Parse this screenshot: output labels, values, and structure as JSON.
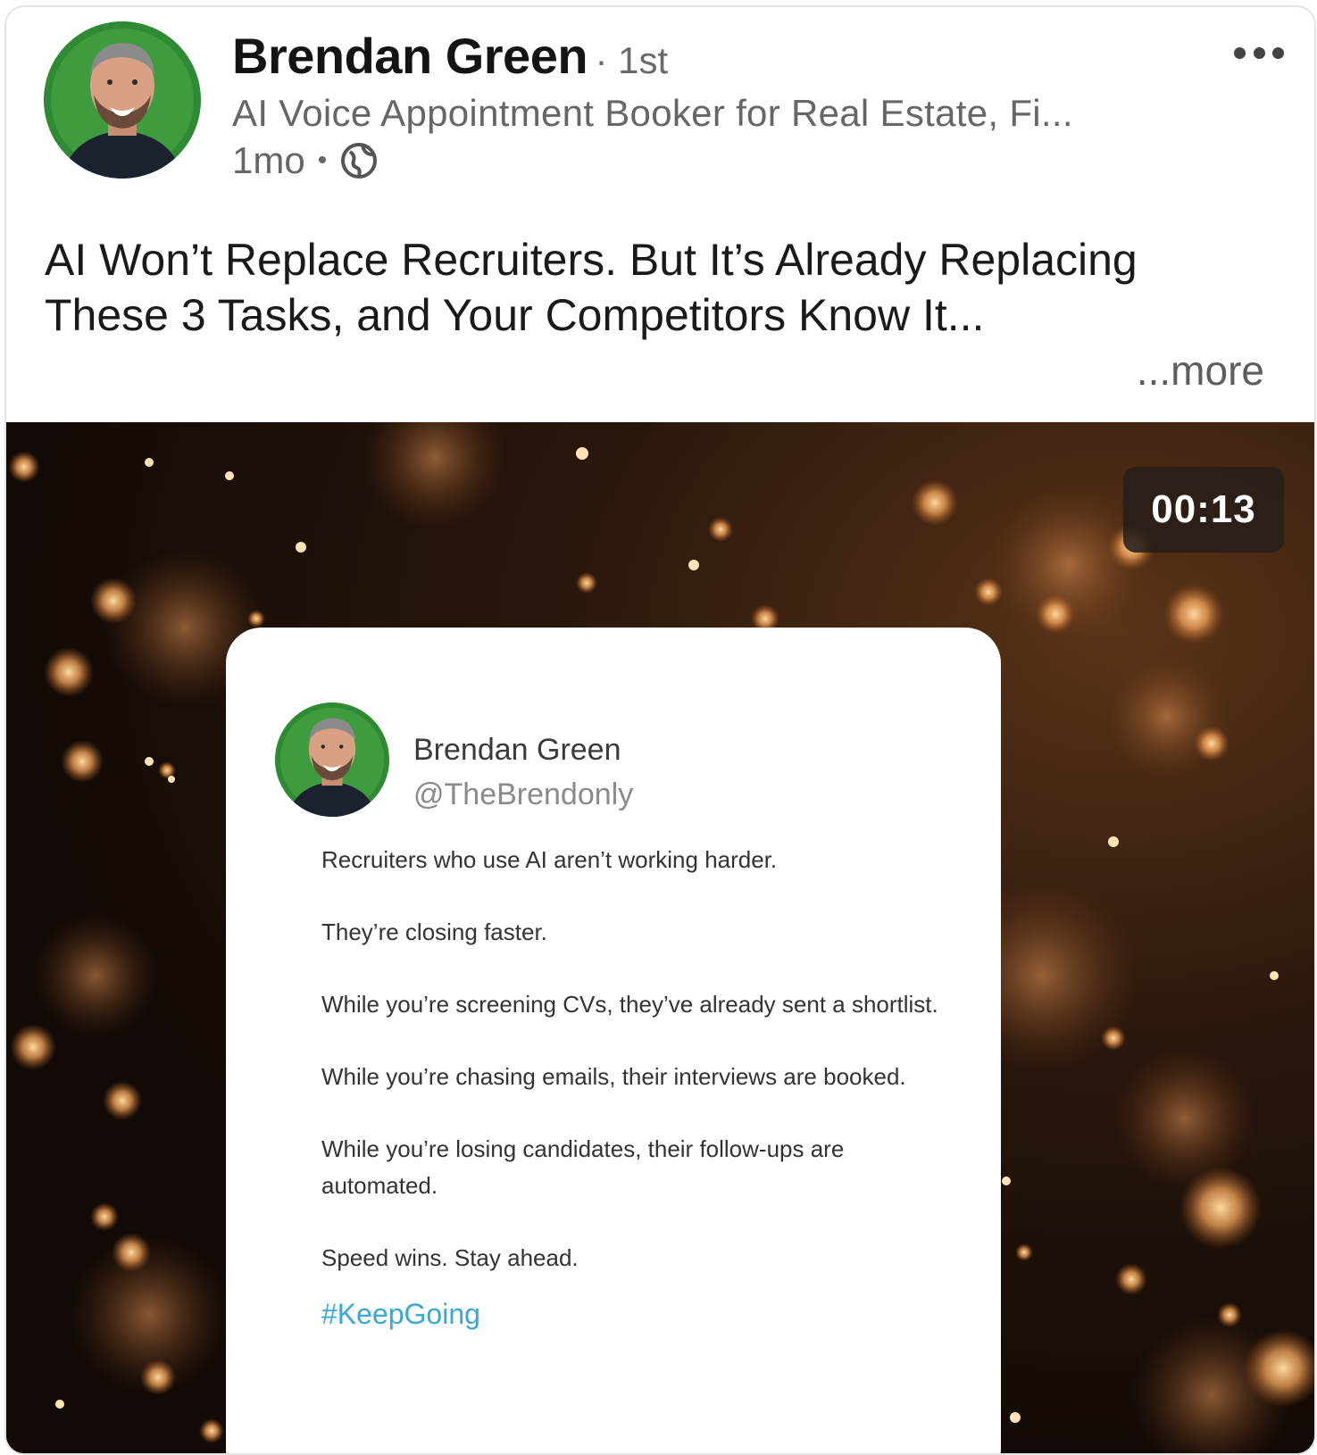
{
  "post": {
    "author_name": "Brendan Green",
    "degree": "· 1st",
    "headline": "AI Voice Appointment Booker for Real Estate, Fi...",
    "time": "1mo",
    "separator": "•",
    "title": "AI Won’t Replace Recruiters. But It’s Already Replacing These 3 Tasks, and Your Competitors Know It...",
    "see_more": "...more"
  },
  "icons": {
    "more": "more-horizontal-icon",
    "visibility": "globe-icon"
  },
  "colors": {
    "avatar_ring": "#2f8a34",
    "hashtag": "#3aa8d6"
  },
  "video": {
    "duration": "00:13",
    "tweet": {
      "name": "Brendan Green",
      "handle": "@TheBrendonly",
      "lines": [
        "Recruiters who use AI aren’t working harder.",
        "They’re closing faster.",
        "While you’re screening CVs, they’ve already sent a shortlist.",
        "While you’re chasing emails, their interviews are booked.",
        "While you’re losing candidates, their follow-ups are automated.",
        "Speed wins. Stay ahead."
      ],
      "hashtag": "#KeepGoing"
    }
  }
}
